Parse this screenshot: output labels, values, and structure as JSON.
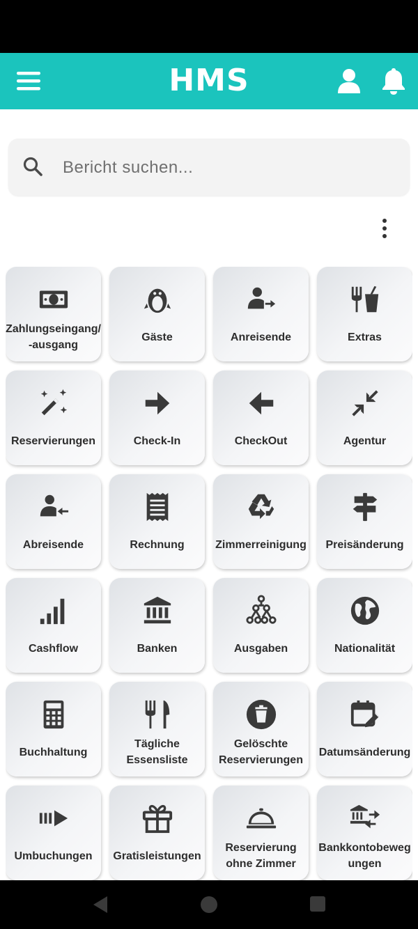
{
  "app": {
    "title": "HMS"
  },
  "search": {
    "placeholder": "Bericht suchen..."
  },
  "colors": {
    "accent": "#1bc4bd",
    "tile_text": "#2d2d2d",
    "icon": "#3a3a3a"
  },
  "tiles": [
    {
      "label": "Zahlungseingang/\n-ausgang",
      "icon": "money-bill-icon"
    },
    {
      "label": "Gäste",
      "icon": "penguin-icon"
    },
    {
      "label": "Anreisende",
      "icon": "user-arrow-right-icon"
    },
    {
      "label": "Extras",
      "icon": "utensils-drink-icon"
    },
    {
      "label": "Reservierungen",
      "icon": "magic-wand-icon"
    },
    {
      "label": "Check-In",
      "icon": "arrow-right-icon"
    },
    {
      "label": "CheckOut",
      "icon": "arrow-left-icon"
    },
    {
      "label": "Agentur",
      "icon": "compress-arrows-icon"
    },
    {
      "label": "Abreisende",
      "icon": "user-arrow-left-icon"
    },
    {
      "label": "Rechnung",
      "icon": "receipt-icon"
    },
    {
      "label": "Zimmerreinigung",
      "icon": "recycle-icon"
    },
    {
      "label": "Preisänderung",
      "icon": "signpost-icon"
    },
    {
      "label": "Cashflow",
      "icon": "signal-bars-icon"
    },
    {
      "label": "Banken",
      "icon": "bank-icon"
    },
    {
      "label": "Ausgaben",
      "icon": "sitemap-icon"
    },
    {
      "label": "Nationalität",
      "icon": "globe-icon"
    },
    {
      "label": "Buchhaltung",
      "icon": "calculator-icon"
    },
    {
      "label": "Tägliche\nEssensliste",
      "icon": "fork-knife-icon"
    },
    {
      "label": "Gelöschte\nReservierungen",
      "icon": "trash-circle-icon"
    },
    {
      "label": "Datumsänderung",
      "icon": "calendar-edit-icon"
    },
    {
      "label": "Umbuchungen",
      "icon": "transfer-arrow-icon"
    },
    {
      "label": "Gratisleistungen",
      "icon": "gift-icon"
    },
    {
      "label": "Reservierung\nohne Zimmer",
      "icon": "room-service-icon"
    },
    {
      "label": "Bankkontobeweg\nungen",
      "icon": "bank-transfer-icon"
    }
  ]
}
